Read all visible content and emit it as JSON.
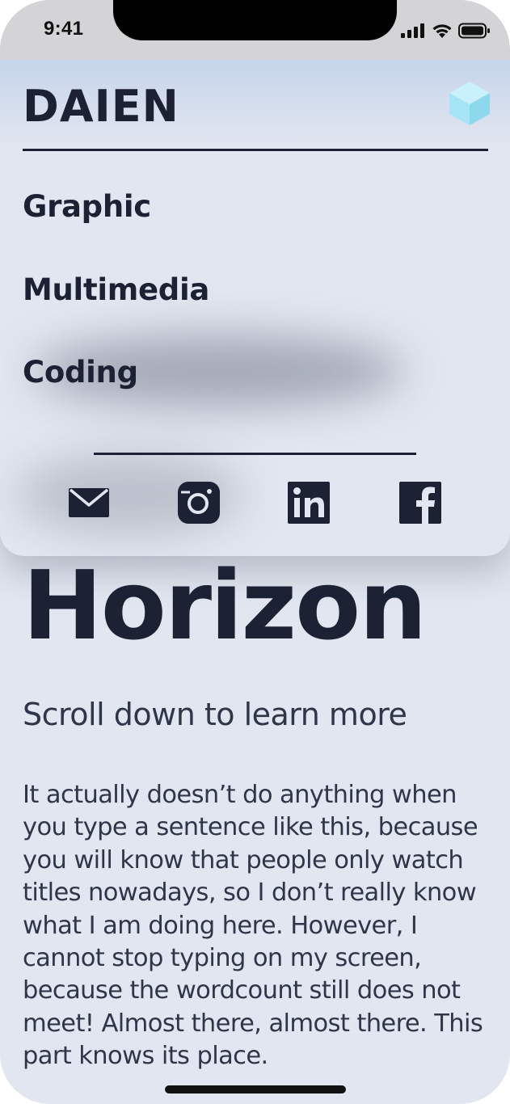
{
  "status_bar": {
    "time": "9:41"
  },
  "menu": {
    "brand": "DAIEN",
    "items": [
      {
        "label": "Graphic"
      },
      {
        "label": "Multimedia"
      },
      {
        "label": "Coding"
      }
    ],
    "social": [
      "mail-icon",
      "instagram-icon",
      "linkedin-icon",
      "facebook-icon"
    ]
  },
  "hero": {
    "title": "Horizon",
    "subtitle": "Scroll down to learn more",
    "body": "It actually doesn’t do anything when you type a sentence like this, because you will know that people only watch titles nowadays, so I don’t really know what I am doing here. However, I cannot stop typing on my screen, because the wordcount still does not meet! Almost there, almost there. This part knows its place."
  },
  "colors": {
    "background": "#e2e6f0",
    "text_dark": "#1c2234",
    "text_body": "#2f3649",
    "logo_accent": "#a9e6f7"
  }
}
